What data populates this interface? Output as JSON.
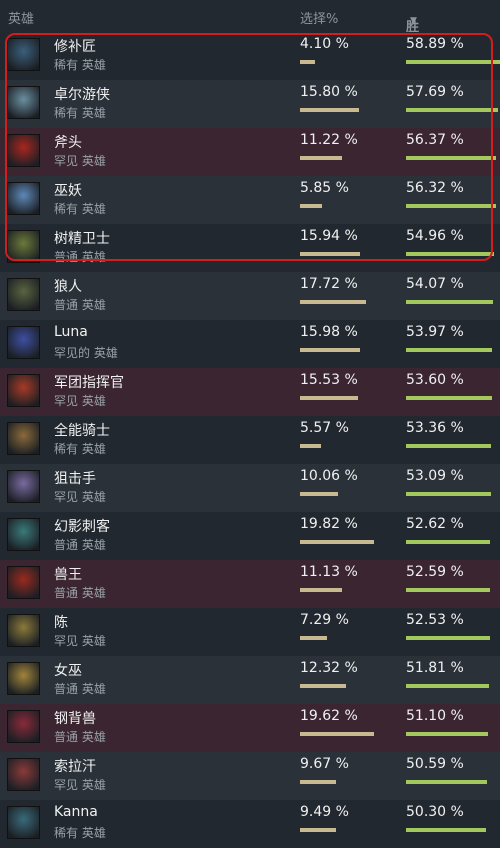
{
  "header": {
    "hero": "英雄",
    "pick_rate": "选择%",
    "win_rate": "胜利%",
    "sort_caret": "▼"
  },
  "rows": [
    {
      "name": "修补匠",
      "rarity": "稀有 英雄",
      "pick": "4.10 %",
      "pick_frac": 0.041,
      "win": "58.89 %",
      "win_frac": 0.5889,
      "bg": "dark",
      "icon": "tinker-portrait",
      "color": "#3b5f7a"
    },
    {
      "name": "卓尔游侠",
      "rarity": "稀有 英雄",
      "pick": "15.80 %",
      "pick_frac": 0.158,
      "win": "57.69 %",
      "win_frac": 0.5769,
      "bg": "light",
      "icon": "drow-ranger-portrait",
      "color": "#6a8fa0"
    },
    {
      "name": "斧头",
      "rarity": "罕见 英雄",
      "pick": "11.22 %",
      "pick_frac": 0.1122,
      "win": "56.37 %",
      "win_frac": 0.5637,
      "bg": "red",
      "icon": "axe-portrait",
      "color": "#a8261f"
    },
    {
      "name": "巫妖",
      "rarity": "稀有 英雄",
      "pick": "5.85 %",
      "pick_frac": 0.0585,
      "win": "56.32 %",
      "win_frac": 0.5632,
      "bg": "light",
      "icon": "lich-portrait",
      "color": "#5e88b8"
    },
    {
      "name": "树精卫士",
      "rarity": "普通 英雄",
      "pick": "15.94 %",
      "pick_frac": 0.1594,
      "win": "54.96 %",
      "win_frac": 0.5496,
      "bg": "dark",
      "icon": "treant-portrait",
      "color": "#6b7a3a"
    },
    {
      "name": "狼人",
      "rarity": "普通 英雄",
      "pick": "17.72 %",
      "pick_frac": 0.1772,
      "win": "54.07 %",
      "win_frac": 0.5407,
      "bg": "light",
      "icon": "lycan-portrait",
      "color": "#5a6440"
    },
    {
      "name": "Luna",
      "rarity": "罕见的 英雄",
      "pick": "15.98 %",
      "pick_frac": 0.1598,
      "win": "53.97 %",
      "win_frac": 0.5397,
      "bg": "dark",
      "icon": "luna-portrait",
      "color": "#3e4fa0"
    },
    {
      "name": "军团指挥官",
      "rarity": "罕见 英雄",
      "pick": "15.53 %",
      "pick_frac": 0.1553,
      "win": "53.60 %",
      "win_frac": 0.536,
      "bg": "red",
      "icon": "legion-commander-portrait",
      "color": "#a83a26"
    },
    {
      "name": "全能骑士",
      "rarity": "稀有 英雄",
      "pick": "5.57 %",
      "pick_frac": 0.0557,
      "win": "53.36 %",
      "win_frac": 0.5336,
      "bg": "dark",
      "icon": "omniknight-portrait",
      "color": "#8a6a3a"
    },
    {
      "name": "狙击手",
      "rarity": "罕见 英雄",
      "pick": "10.06 %",
      "pick_frac": 0.1006,
      "win": "53.09 %",
      "win_frac": 0.5309,
      "bg": "light",
      "icon": "sniper-portrait",
      "color": "#7a6aa0"
    },
    {
      "name": "幻影刺客",
      "rarity": "普通 英雄",
      "pick": "19.82 %",
      "pick_frac": 0.1982,
      "win": "52.62 %",
      "win_frac": 0.5262,
      "bg": "dark",
      "icon": "phantom-assassin-portrait",
      "color": "#3a7a7a"
    },
    {
      "name": "兽王",
      "rarity": "普通 英雄",
      "pick": "11.13 %",
      "pick_frac": 0.1113,
      "win": "52.59 %",
      "win_frac": 0.5259,
      "bg": "red",
      "icon": "beastmaster-portrait",
      "color": "#9a2a1f"
    },
    {
      "name": "陈",
      "rarity": "罕见 英雄",
      "pick": "7.29 %",
      "pick_frac": 0.0729,
      "win": "52.53 %",
      "win_frac": 0.5253,
      "bg": "dark",
      "icon": "chen-portrait",
      "color": "#8a7a3a"
    },
    {
      "name": "女巫",
      "rarity": "普通 英雄",
      "pick": "12.32 %",
      "pick_frac": 0.1232,
      "win": "51.81 %",
      "win_frac": 0.5181,
      "bg": "light",
      "icon": "enchantress-portrait",
      "color": "#a0843a"
    },
    {
      "name": "钢背兽",
      "rarity": "普通 英雄",
      "pick": "19.62 %",
      "pick_frac": 0.1962,
      "win": "51.10 %",
      "win_frac": 0.511,
      "bg": "red",
      "icon": "bristleback-portrait",
      "color": "#8a2a3a"
    },
    {
      "name": "索拉汗",
      "rarity": "罕见 英雄",
      "pick": "9.67 %",
      "pick_frac": 0.0967,
      "win": "50.59 %",
      "win_frac": 0.5059,
      "bg": "light",
      "icon": "shadow-demon-portrait",
      "color": "#8a3a3a"
    },
    {
      "name": "Kanna",
      "rarity": "稀有 英雄",
      "pick": "9.49 %",
      "pick_frac": 0.0949,
      "win": "50.30 %",
      "win_frac": 0.503,
      "bg": "dark",
      "icon": "kanna-portrait",
      "color": "#3a6a7a"
    }
  ]
}
